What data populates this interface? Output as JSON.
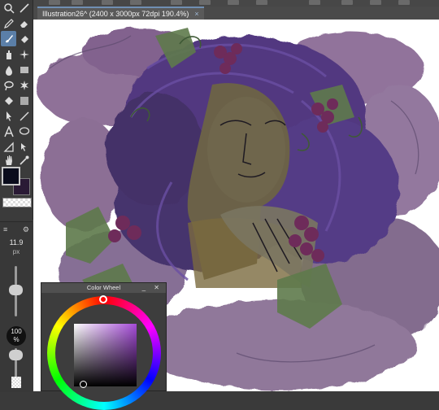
{
  "document": {
    "tab_title": "Illustration26^ (2400 x 3000px 72dpi 190.4%)",
    "close_symbol": "×"
  },
  "brush": {
    "size_value": "11.9",
    "size_unit": "px",
    "opacity_value": "100",
    "opacity_unit": "%"
  },
  "color_wheel": {
    "title": "Color Wheel",
    "controls": "_ ✕",
    "hue_color": "#a54bd8"
  },
  "colors": {
    "main": "#0a0c1c",
    "sub": "#2a1a35",
    "accent": "#5b7fa8"
  }
}
